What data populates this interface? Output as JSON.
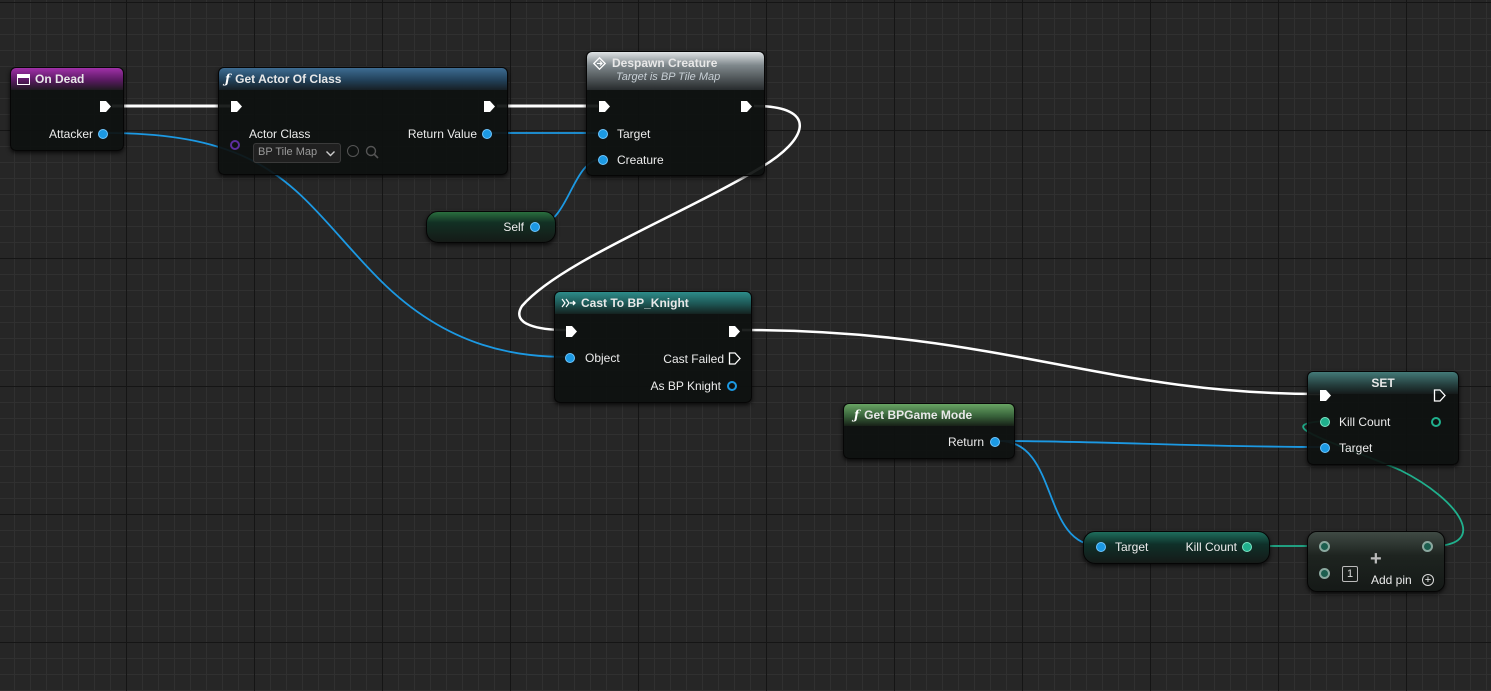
{
  "nodes": {
    "on_dead": {
      "title": "On Dead",
      "attacker": "Attacker"
    },
    "get_actor_of_class": {
      "title": "Get Actor Of Class",
      "actor_class": "Actor Class",
      "class_value": "BP Tile Map",
      "return_value": "Return Value"
    },
    "despawn_creature": {
      "title": "Despawn Creature",
      "subtitle": "Target is BP Tile Map",
      "target": "Target",
      "creature": "Creature"
    },
    "self": {
      "label": "Self"
    },
    "cast_to_knight": {
      "title": "Cast To BP_Knight",
      "object": "Object",
      "cast_failed": "Cast Failed",
      "as_knight": "As BP Knight"
    },
    "get_game_mode": {
      "title": "Get BPGame Mode",
      "return": "Return"
    },
    "set_node": {
      "title": "SET",
      "kill_count": "Kill Count",
      "target": "Target"
    },
    "get_kill_count": {
      "target": "Target",
      "kill_count": "Kill Count"
    },
    "add_node": {
      "operand_value": "1",
      "add_pin": "Add pin",
      "plus": "+"
    }
  },
  "icons": {
    "function": "ƒ",
    "event": "event-icon",
    "macro": "diamond-exec-icon",
    "cast": "cast-arrow-icon",
    "dropdown_chevron": "chevron-down-icon",
    "use_selected": "arrow-left-circle-icon",
    "browse": "search-icon",
    "add_pin": "plus-circle-icon"
  },
  "colors": {
    "background": "#262626",
    "object_pin": "#1c99e3",
    "integer_pin": "#20b08d",
    "class_pin": "#5d2ea0",
    "exec_wire": "#ffffff"
  }
}
